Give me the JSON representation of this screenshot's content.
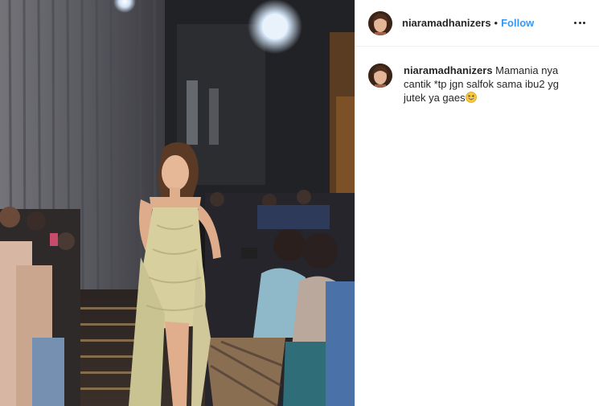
{
  "post": {
    "username": "niaramadhanizers",
    "separator": "•",
    "follow_label": "Follow"
  },
  "comment": {
    "username": "niaramadhanizers",
    "text": "Mamania nya cantik *tp jgn salfok sama ibu2 yg jutek ya gaes",
    "emoji": "grinning-squinting-face"
  },
  "icons": {
    "more": "more-options-icon"
  }
}
